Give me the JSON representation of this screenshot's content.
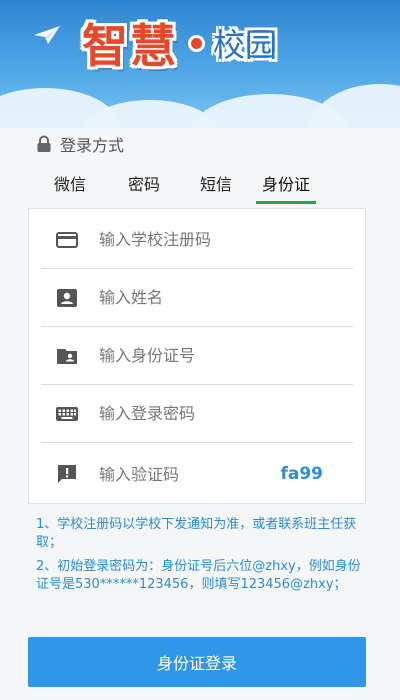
{
  "banner": {
    "logo_main": "智慧",
    "logo_sub": "校园",
    "background": "#3a95dc",
    "logo_color": "#e8482a",
    "logo_sub_color": "#2b73c2"
  },
  "login_mode": {
    "title": "登录方式",
    "icon": "lock-icon"
  },
  "tabs": [
    {
      "label": "微信",
      "active": false
    },
    {
      "label": "密码",
      "active": false
    },
    {
      "label": "短信",
      "active": false
    },
    {
      "label": "身份证",
      "active": true
    }
  ],
  "tab_active_color": "#2e9e4f",
  "form": {
    "school_code": {
      "placeholder": "输入学校注册码",
      "value": "",
      "icon": "card-icon"
    },
    "name": {
      "placeholder": "输入姓名",
      "value": "",
      "icon": "person-badge-icon"
    },
    "id_number": {
      "placeholder": "输入身份证号",
      "value": "",
      "icon": "id-folder-icon"
    },
    "password": {
      "placeholder": "输入登录密码",
      "value": "",
      "icon": "keyboard-icon"
    },
    "captcha": {
      "placeholder": "输入验证码",
      "value": "",
      "icon": "alert-message-icon",
      "code": "fa99"
    }
  },
  "notes": [
    "1、学校注册码以学校下发通知为准，或者联系班主任获取；",
    "2、初始登录密码为：身份证号后六位@zhxy，例如身份证号是530******123456，则填写123456@zhxy；"
  ],
  "notes_color": "#2d8cd6",
  "submit": {
    "label": "身份证登录",
    "color": "#2f96ea"
  }
}
